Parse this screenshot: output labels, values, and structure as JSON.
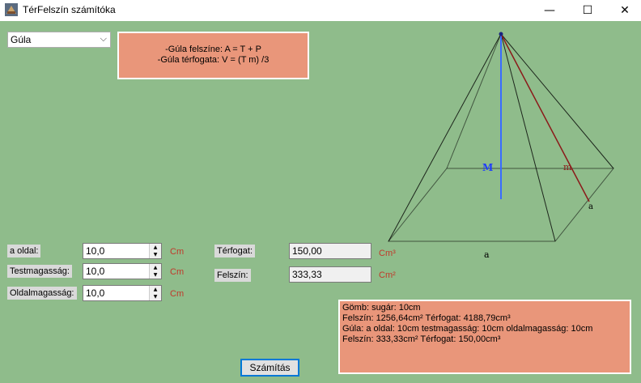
{
  "window": {
    "title": "TérFelszín számítóka",
    "minimize": "—",
    "maximize": "☐",
    "close": "✕"
  },
  "shape_select": {
    "value": "Gúla",
    "arrow": "⌵"
  },
  "formula": {
    "line1": "-Gúla felszíne: A = T + P",
    "line2": "-Gúla térfogata: V = (T m) /3"
  },
  "inputs": [
    {
      "label": "a oldal:",
      "value": "10,0",
      "unit": "Cm"
    },
    {
      "label": "Testmagasság:",
      "value": "10,0",
      "unit": "Cm"
    },
    {
      "label": "Oldalmagasság:",
      "value": "10,0",
      "unit": "Cm"
    }
  ],
  "outputs": [
    {
      "label": "Térfogat:",
      "value": "150,00",
      "unit": "Cm³"
    },
    {
      "label": "Felszín:",
      "value": "333,33",
      "unit": "Cm²"
    }
  ],
  "results": [
    "Gömb: sugár: 10cm",
    "Felszín: 1256,64cm² Térfogat: 4188,79cm³",
    "Gúla: a oldal: 10cm testmagasság: 10cm oldalmagasság: 10cm",
    "Felszín: 333,33cm² Térfogat: 150,00cm³"
  ],
  "calc_button": "Számítás",
  "diagram": {
    "label_M": "M",
    "label_m": "m",
    "label_a_bottom": "a",
    "label_a_side": "a"
  },
  "colors": {
    "background": "#8fbc8b",
    "panel": "#e9967a",
    "unit": "#c0392b"
  }
}
